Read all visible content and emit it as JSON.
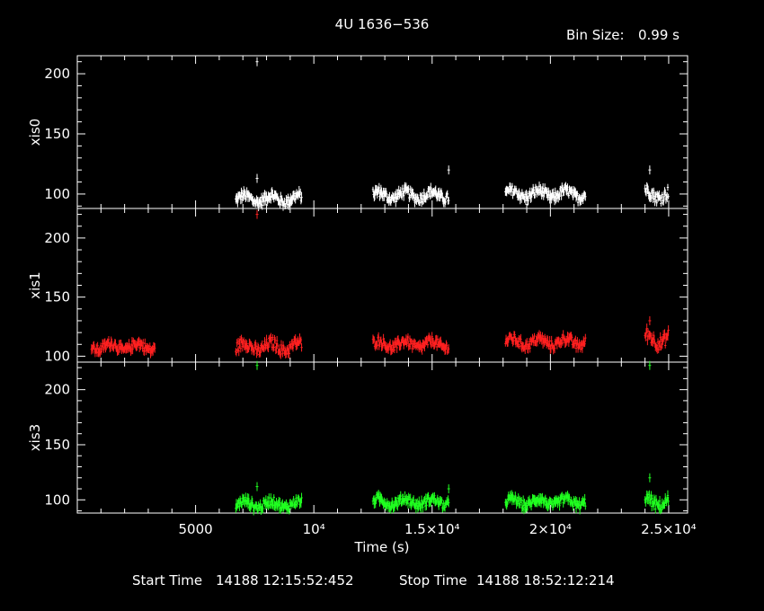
{
  "title": "4U 1636−536",
  "bin_size_label": "Bin Size:",
  "bin_size_value": "0.99 s",
  "xlabel": "Time (s)",
  "footer": {
    "start_label": "Start Time",
    "start_value": "14188 12:15:52:452",
    "stop_label": "Stop Time",
    "stop_value": "14188 18:52:12:214"
  },
  "x_ticks": [
    {
      "value": 5000,
      "label": "5000"
    },
    {
      "value": 10000,
      "label": "10⁴"
    },
    {
      "value": 15000,
      "label": "1.5×10⁴"
    },
    {
      "value": 20000,
      "label": "2×10⁴"
    },
    {
      "value": 25000,
      "label": "2.5×10⁴"
    }
  ],
  "chart_data": {
    "type": "scatter",
    "title": "4U 1636−536",
    "xlabel": "Time (s)",
    "xlim": [
      0,
      25800
    ],
    "x_tick_values": [
      5000,
      10000,
      15000,
      20000,
      25000
    ],
    "panels": [
      {
        "name": "xis0",
        "ylabel": "xis0",
        "color": "#ffffff",
        "ylim": [
          88,
          215
        ],
        "yticks": [
          100,
          150,
          200
        ],
        "ytick_labels": [
          "100",
          "150",
          "200"
        ],
        "segments": [
          {
            "x_range": [
              6700,
              9500
            ],
            "level": 96,
            "spread": 5
          },
          {
            "x_range": [
              12500,
              15700
            ],
            "level": 99,
            "spread": 5
          },
          {
            "x_range": [
              18100,
              21500
            ],
            "level": 100,
            "spread": 5
          },
          {
            "x_range": [
              24000,
              25000
            ],
            "level": 100,
            "spread": 6
          }
        ],
        "spikes": [
          {
            "x": 7600,
            "y": 210
          },
          {
            "x": 7600,
            "y": 113
          },
          {
            "x": 15700,
            "y": 120
          },
          {
            "x": 24200,
            "y": 120
          }
        ]
      },
      {
        "name": "xis1",
        "ylabel": "xis1",
        "color": "#ff2020",
        "ylim": [
          95,
          225
        ],
        "yticks": [
          100,
          150,
          200
        ],
        "ytick_labels": [
          "100",
          "150",
          "200"
        ],
        "segments": [
          {
            "x_range": [
              600,
              3300
            ],
            "level": 108,
            "spread": 5
          },
          {
            "x_range": [
              6700,
              9500
            ],
            "level": 108,
            "spread": 6
          },
          {
            "x_range": [
              12500,
              15700
            ],
            "level": 110,
            "spread": 5
          },
          {
            "x_range": [
              18100,
              21500
            ],
            "level": 112,
            "spread": 5
          },
          {
            "x_range": [
              24000,
              25000
            ],
            "level": 115,
            "spread": 7
          }
        ],
        "spikes": [
          {
            "x": 7600,
            "y": 220
          },
          {
            "x": 24200,
            "y": 130
          }
        ]
      },
      {
        "name": "xis3",
        "ylabel": "xis3",
        "color": "#20ff20",
        "ylim": [
          88,
          225
        ],
        "yticks": [
          100,
          150,
          200
        ],
        "ytick_labels": [
          "100",
          "150",
          "200"
        ],
        "segments": [
          {
            "x_range": [
              6700,
              9500
            ],
            "level": 96,
            "spread": 5
          },
          {
            "x_range": [
              12500,
              15700
            ],
            "level": 98,
            "spread": 5
          },
          {
            "x_range": [
              18100,
              21500
            ],
            "level": 98,
            "spread": 5
          },
          {
            "x_range": [
              24000,
              25000
            ],
            "level": 98,
            "spread": 6
          }
        ],
        "spikes": [
          {
            "x": 7600,
            "y": 222
          },
          {
            "x": 7600,
            "y": 112
          },
          {
            "x": 15700,
            "y": 110
          },
          {
            "x": 24200,
            "y": 120
          },
          {
            "x": 24200,
            "y": 222
          }
        ]
      }
    ]
  }
}
